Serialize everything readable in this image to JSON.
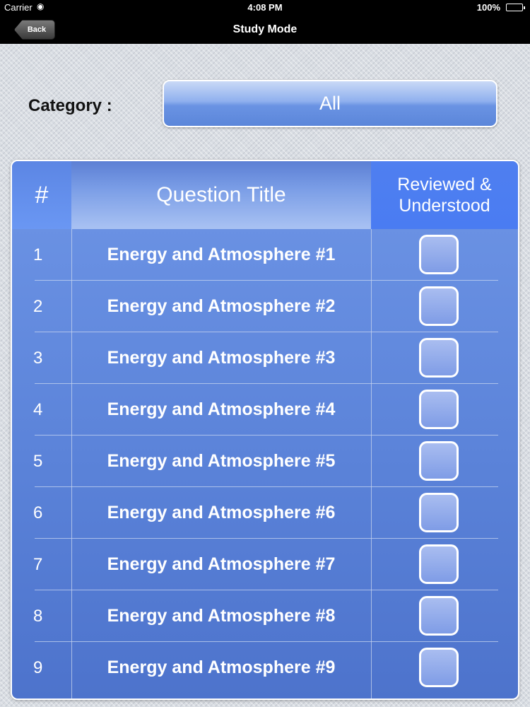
{
  "status_bar": {
    "carrier": "Carrier",
    "time": "4:08 PM",
    "battery": "100%"
  },
  "nav": {
    "back_label": "Back",
    "title": "Study Mode"
  },
  "category": {
    "label": "Category :",
    "value": "All"
  },
  "table": {
    "headers": {
      "number": "#",
      "title": "Question Title",
      "reviewed_line1": "Reviewed &",
      "reviewed_line2": "Understood"
    },
    "rows": [
      {
        "num": "1",
        "title": "Energy and Atmosphere #1",
        "checked": false
      },
      {
        "num": "2",
        "title": "Energy and Atmosphere #2",
        "checked": false
      },
      {
        "num": "3",
        "title": "Energy and Atmosphere #3",
        "checked": false
      },
      {
        "num": "4",
        "title": "Energy and Atmosphere #4",
        "checked": false
      },
      {
        "num": "5",
        "title": "Energy and Atmosphere #5",
        "checked": false
      },
      {
        "num": "6",
        "title": "Energy and Atmosphere #6",
        "checked": false
      },
      {
        "num": "7",
        "title": "Energy and Atmosphere #7",
        "checked": false
      },
      {
        "num": "8",
        "title": "Energy and Atmosphere #8",
        "checked": false
      },
      {
        "num": "9",
        "title": "Energy and Atmosphere #9",
        "checked": false
      }
    ]
  }
}
